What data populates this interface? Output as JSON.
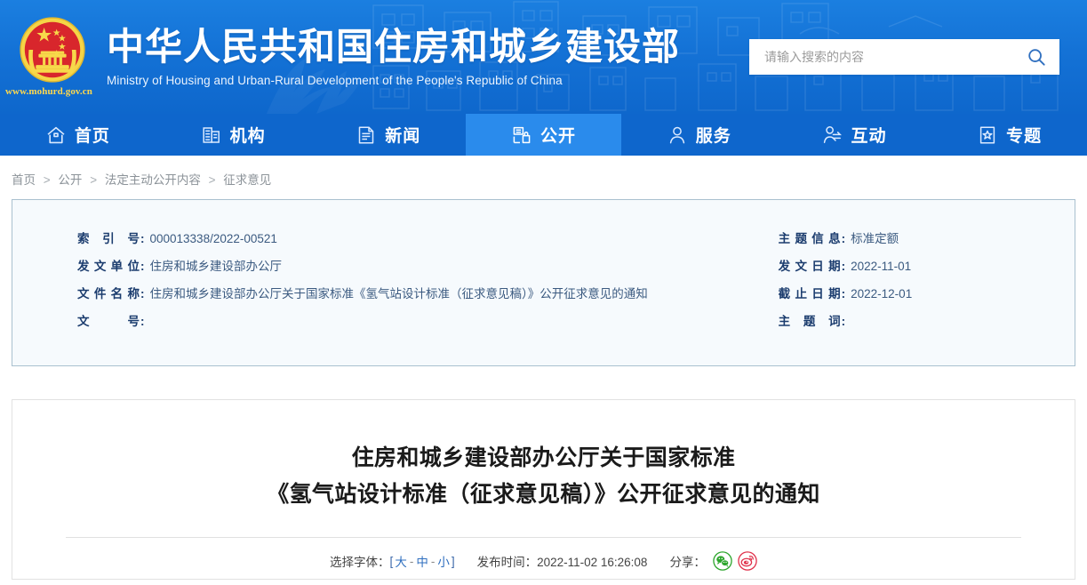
{
  "header": {
    "emblem_icon": "china-national-emblem",
    "site_url": "www.mohurd.gov.cn",
    "title_cn": "中华人民共和国住房和城乡建设部",
    "title_en": "Ministry of Housing and Urban-Rural Development of the People's Republic of China",
    "search": {
      "placeholder": "请输入搜索的内容",
      "value": "",
      "button_icon": "search-icon"
    },
    "colors": {
      "bg_top": "#1b7fe0",
      "bg_bottom": "#0e67cc"
    }
  },
  "nav": {
    "items": [
      {
        "label": "首页",
        "icon": "home-icon",
        "active": false
      },
      {
        "label": "机构",
        "icon": "building-icon",
        "active": false
      },
      {
        "label": "新闻",
        "icon": "news-document-icon",
        "active": false
      },
      {
        "label": "公开",
        "icon": "open-disclosure-icon",
        "active": true
      },
      {
        "label": "服务",
        "icon": "person-service-icon",
        "active": false
      },
      {
        "label": "互动",
        "icon": "interaction-icon",
        "active": false
      },
      {
        "label": "专题",
        "icon": "star-topic-icon",
        "active": false
      }
    ],
    "colors": {
      "bar": "#0e66cc",
      "active": "#2a8bec"
    }
  },
  "breadcrumb": {
    "items": [
      "首页",
      "公开",
      "法定主动公开内容",
      "征求意见"
    ],
    "separator": ">"
  },
  "info_panel": {
    "left": [
      {
        "label": "索引号",
        "value": "000013338/2022-00521"
      },
      {
        "label": "发文单位",
        "value": "住房和城乡建设部办公厅"
      },
      {
        "label": "文件名称",
        "value": "住房和城乡建设部办公厅关于国家标准《氢气站设计标准（征求意见稿）》公开征求意见的通知"
      },
      {
        "label": "文号",
        "value": ""
      }
    ],
    "right": [
      {
        "label": "主题信息",
        "value": "标准定额"
      },
      {
        "label": "发文日期",
        "value": "2022-11-01"
      },
      {
        "label": "截止日期",
        "value": "2022-12-01"
      },
      {
        "label": "主题词",
        "value": ""
      }
    ]
  },
  "article": {
    "title_line1": "住房和城乡建设部办公厅关于国家标准",
    "title_line2": "《氢气站设计标准（征求意见稿）》公开征求意见的通知",
    "fontsize": {
      "label": "选择字体：",
      "bracket_open": "[",
      "bracket_close": "]",
      "options": [
        "大",
        "中",
        "小"
      ],
      "dash": "-"
    },
    "publish": {
      "label": "发布时间：",
      "value": "2022-11-02 16:26:08"
    },
    "share": {
      "label": "分享：",
      "items": [
        {
          "name": "wechat",
          "icon": "wechat-icon",
          "color": "#2ca52c"
        },
        {
          "name": "weibo",
          "icon": "weibo-icon",
          "color": "#e0304a"
        }
      ]
    }
  }
}
